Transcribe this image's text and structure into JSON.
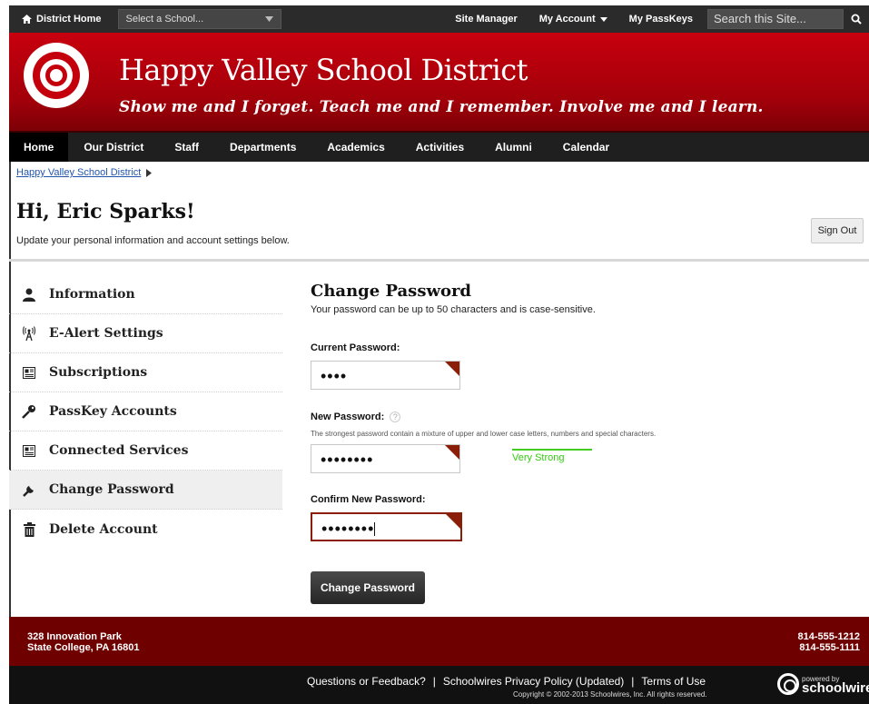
{
  "topbar": {
    "home_label": "District Home",
    "school_select": "Select a School...",
    "site_manager": "Site Manager",
    "my_account": "My Account",
    "my_passkeys": "My PassKeys",
    "search_placeholder": "Search this Site..."
  },
  "header": {
    "title": "Happy Valley School District",
    "tagline": "Show me and I forget. Teach me and I remember. Involve me and I learn."
  },
  "nav": {
    "items": [
      "Home",
      "Our District",
      "Staff",
      "Departments",
      "Academics",
      "Activities",
      "Alumni",
      "Calendar"
    ]
  },
  "breadcrumb": {
    "link": "Happy Valley School District"
  },
  "account": {
    "greeting": "Hi, Eric Sparks!",
    "subtitle": "Update your personal information and account settings below.",
    "sign_out": "Sign Out"
  },
  "sidebar": {
    "items": [
      {
        "label": "Information",
        "icon": "person-icon"
      },
      {
        "label": "E-Alert Settings",
        "icon": "antenna-icon"
      },
      {
        "label": "Subscriptions",
        "icon": "newspaper-icon"
      },
      {
        "label": "PassKey Accounts",
        "icon": "key-icon"
      },
      {
        "label": "Connected Services",
        "icon": "newspaper-icon"
      },
      {
        "label": "Change Password",
        "icon": "wrench-icon"
      },
      {
        "label": "Delete Account",
        "icon": "trash-icon"
      }
    ],
    "active": "Change Password"
  },
  "form": {
    "title": "Change Password",
    "description": "Your password can be up to 50 characters and is case-sensitive.",
    "current_label": "Current Password:",
    "current_value": "••••",
    "new_label": "New Password:",
    "new_help": "?",
    "new_hint": "The strongest password contain a mixture of upper and lower case letters, numbers and special characters.",
    "new_value": "••••••••",
    "strength": "Very Strong",
    "confirm_label": "Confirm New Password:",
    "confirm_value": "••••••••",
    "submit": "Change Password"
  },
  "footer": {
    "address_line1": "328 Innovation Park",
    "address_line2": "State College, PA 16801",
    "phone1": "814-555-1212",
    "phone2": "814-555-1111",
    "link_feedback": "Questions or Feedback?",
    "link_privacy": "Schoolwires Privacy Policy (Updated)",
    "link_terms": "Terms of Use",
    "separator": "|",
    "copyright": "Copyright © 2002-2013 Schoolwires, Inc. All rights reserved.",
    "powered_by": "powered by",
    "brand": "schoolwires"
  },
  "colors": {
    "accent": "#c4000d",
    "nav": "#1f1f1f",
    "footer": "#6f0000",
    "strength": "#33cc11"
  }
}
